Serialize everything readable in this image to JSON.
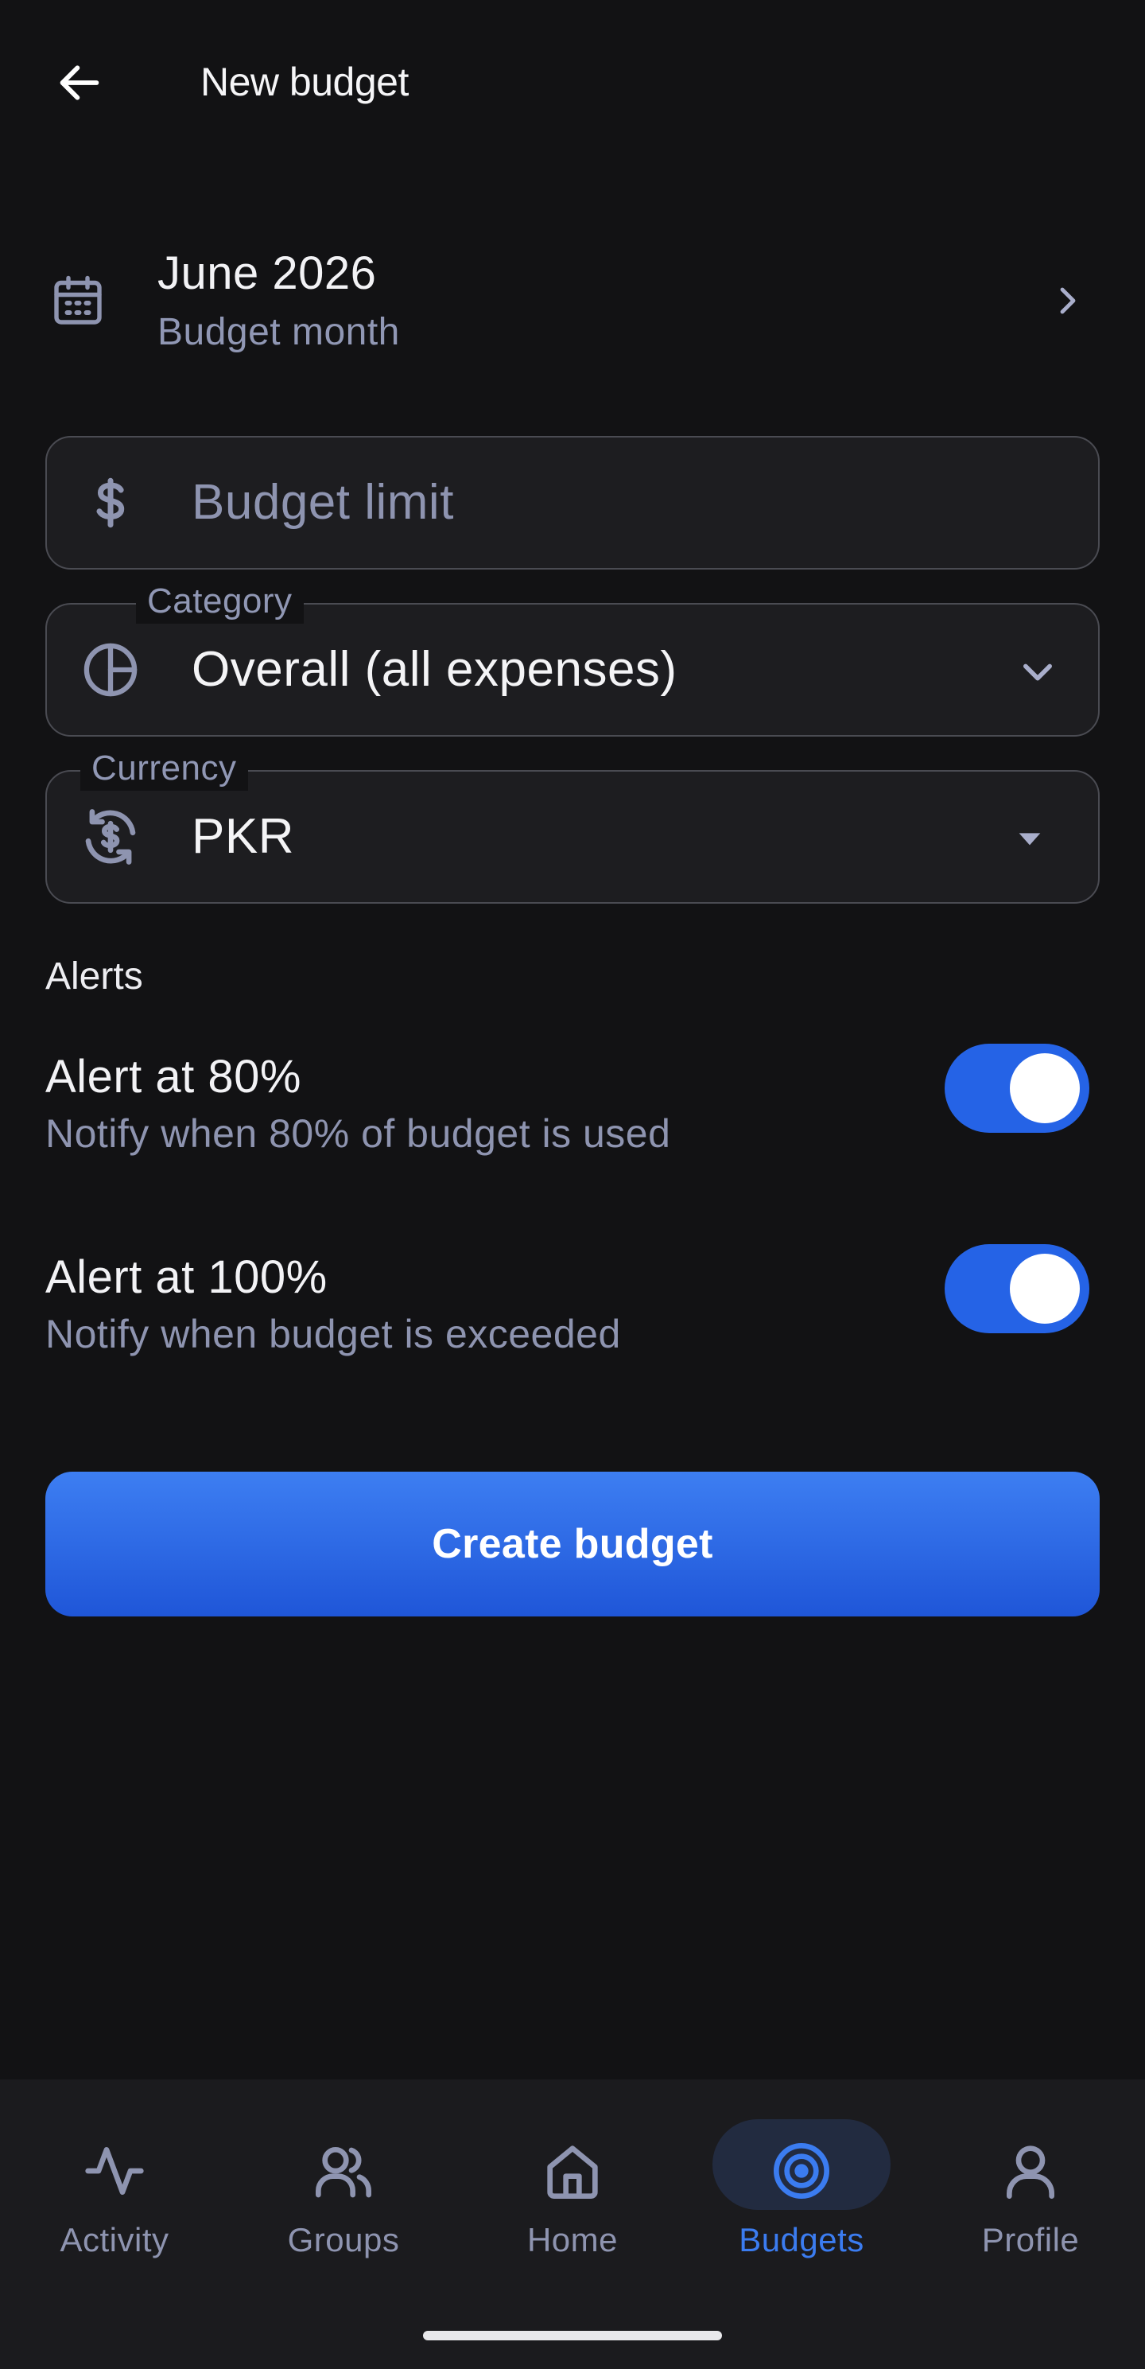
{
  "header": {
    "title": "New budget"
  },
  "month": {
    "value": "June 2026",
    "label": "Budget month"
  },
  "budget_limit": {
    "placeholder": "Budget limit"
  },
  "category": {
    "label": "Category",
    "value": "Overall (all expenses)"
  },
  "currency": {
    "label": "Currency",
    "value": "PKR"
  },
  "alerts": {
    "section_label": "Alerts",
    "items": [
      {
        "title": "Alert at 80%",
        "description": "Notify when 80% of budget is used",
        "enabled": true
      },
      {
        "title": "Alert at 100%",
        "description": "Notify when budget is exceeded",
        "enabled": true
      }
    ]
  },
  "actions": {
    "create_label": "Create budget"
  },
  "nav": {
    "items": [
      {
        "label": "Activity",
        "icon": "activity-icon"
      },
      {
        "label": "Groups",
        "icon": "groups-icon"
      },
      {
        "label": "Home",
        "icon": "home-icon"
      },
      {
        "label": "Budgets",
        "icon": "budgets-icon",
        "active": true
      },
      {
        "label": "Profile",
        "icon": "profile-icon"
      }
    ]
  },
  "colors": {
    "accent": "#2563e6",
    "background": "#121214",
    "muted_text": "#8e94b0"
  }
}
